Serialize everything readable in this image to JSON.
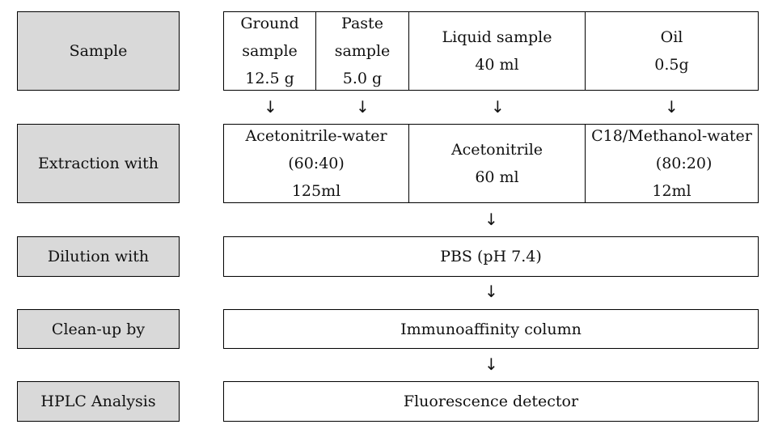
{
  "steps": {
    "sample": {
      "label": "Sample",
      "cells": [
        "Ground\nsample\n12.5 g",
        "Paste\nsample\n5.0 g",
        "Liquid sample\n40 ml",
        "Oil\n0.5g"
      ]
    },
    "extraction": {
      "label": "Extraction with",
      "cells": [
        "Acetonitrile-water\n(60:40)\n125ml",
        "Acetonitrile\n60 ml",
        "C18/Methanol-water\n     (80:20)\n12ml"
      ]
    },
    "dilution": {
      "label": "Dilution with",
      "value": "PBS (pH 7.4)"
    },
    "cleanup": {
      "label": "Clean-up by",
      "value": "Immunoaffinity column"
    },
    "hplc": {
      "label": "HPLC Analysis",
      "value": "Fluorescence detector"
    }
  },
  "arrow_glyph": "↓",
  "colors": {
    "label_fill": "#d9d9d9",
    "border": "#000000"
  }
}
